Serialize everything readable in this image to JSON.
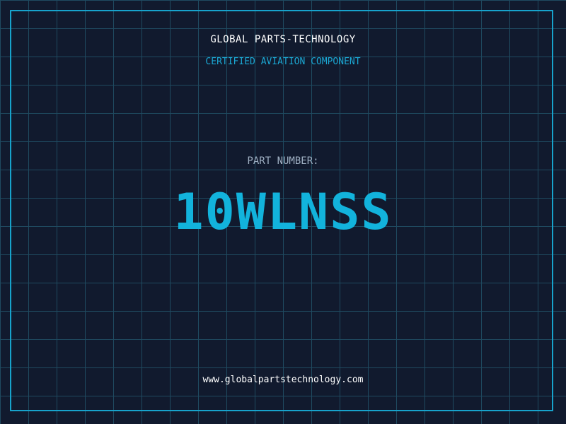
{
  "label": {
    "company": "GLOBAL PARTS-TECHNOLOGY",
    "subtitle": "CERTIFIED AVIATION COMPONENT",
    "part_number_label": "PART NUMBER:",
    "part_number": "10WLNSS",
    "website": "www.globalpartstechnology.com"
  },
  "colors": {
    "background": "#111a2e",
    "grid": "#1f4a60",
    "accent": "#17a3cc",
    "text": "#ffffff",
    "muted": "#9fb0c3"
  }
}
